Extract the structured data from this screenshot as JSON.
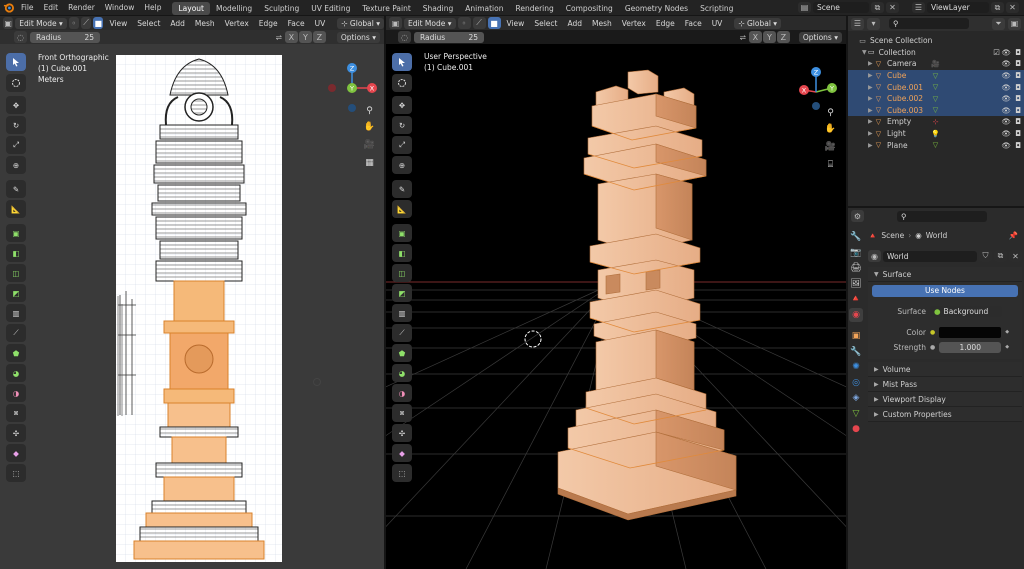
{
  "menus": [
    "File",
    "Edit",
    "Render",
    "Window",
    "Help"
  ],
  "workspaces": [
    "Layout",
    "Modelling",
    "Sculpting",
    "UV Editing",
    "Texture Paint",
    "Shading",
    "Animation",
    "Rendering",
    "Compositing",
    "Geometry Nodes",
    "Scripting"
  ],
  "scene_name": "Scene",
  "view_layer_name": "ViewLayer",
  "left_viewport": {
    "mode": "Edit Mode",
    "menus": [
      "View",
      "Select",
      "Add",
      "Mesh",
      "Vertex",
      "Edge",
      "Face",
      "UV"
    ],
    "orientation": "Global",
    "radius_label": "Radius",
    "radius_value": "25",
    "axes": [
      "X",
      "Y",
      "Z"
    ],
    "options": "Options",
    "view_name": "Front Orthographic",
    "object_label": "(1) Cube.001",
    "units": "Meters"
  },
  "right_viewport": {
    "mode": "Edit Mode",
    "menus": [
      "View",
      "Select",
      "Add",
      "Mesh",
      "Vertex",
      "Edge",
      "Face",
      "UV"
    ],
    "orientation": "Global",
    "radius_label": "Radius",
    "radius_value": "25",
    "axes": [
      "X",
      "Y",
      "Z"
    ],
    "options": "Options",
    "view_name": "User Perspective",
    "object_label": "(1) Cube.001"
  },
  "gizmo_axes": {
    "x": "X",
    "y": "Y",
    "z": "Z"
  },
  "outliner": {
    "root": "Scene Collection",
    "collection": "Collection",
    "items": [
      {
        "name": "Camera",
        "selected": false
      },
      {
        "name": "Cube",
        "selected": true
      },
      {
        "name": "Cube.001",
        "selected": true
      },
      {
        "name": "Cube.002",
        "selected": true
      },
      {
        "name": "Cube.003",
        "selected": true
      },
      {
        "name": "Empty",
        "selected": false
      },
      {
        "name": "Light",
        "selected": false
      },
      {
        "name": "Plane",
        "selected": false
      }
    ]
  },
  "properties": {
    "breadcrumb_scene": "Scene",
    "breadcrumb_world": "World",
    "world_name": "World",
    "surface_panel": "Surface",
    "use_nodes_button": "Use Nodes",
    "surface_label": "Surface",
    "surface_value": "Background",
    "color_label": "Color",
    "strength_label": "Strength",
    "strength_value": "1.000",
    "collapsed_panels": [
      "Volume",
      "Mist Pass",
      "Viewport Display",
      "Custom Properties"
    ]
  },
  "colors": {
    "accent_blue": "#4772b3",
    "selected_orange": "#f1a359",
    "model_peach": "#e8b08a",
    "axis_x": "#e5464e",
    "axis_y": "#7fc33f",
    "axis_z": "#3d8fe0"
  }
}
